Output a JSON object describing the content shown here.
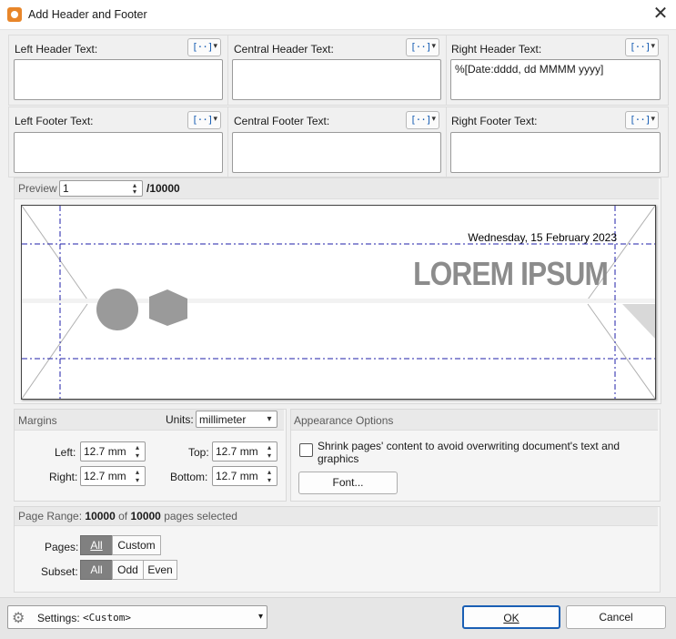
{
  "window": {
    "title": "Add Header and Footer"
  },
  "header": {
    "left_label": "Left Header Text:",
    "central_label": "Central Header Text:",
    "right_label": "Right Header Text:",
    "left_value": "",
    "central_value": "",
    "right_value": "%[Date:dddd, dd MMMM yyyy]"
  },
  "footer": {
    "left_label": "Left Footer Text:",
    "central_label": "Central Footer Text:",
    "right_label": "Right Footer Text:",
    "left_value": "",
    "central_value": "",
    "right_value": ""
  },
  "preview": {
    "label": "Preview",
    "page_value": "1",
    "total": "/10000",
    "date_text": "Wednesday, 15 February 2023",
    "lorem_text": "LOREM IPSUM"
  },
  "margins": {
    "title": "Margins",
    "units_label": "Units:",
    "units_value": "millimeter",
    "left_label": "Left:",
    "left_value": "12.7 mm",
    "right_label": "Right:",
    "right_value": "12.7 mm",
    "top_label": "Top:",
    "top_value": "12.7 mm",
    "bottom_label": "Bottom:",
    "bottom_value": "12.7 mm"
  },
  "appearance": {
    "title": "Appearance Options",
    "shrink_line1": "Shrink pages' content to avoid overwriting document's text and",
    "shrink_line2": "graphics",
    "font_button": "Font..."
  },
  "page_range": {
    "prefix": "Page Range:",
    "selected": "10000",
    "of": "of",
    "total": "10000",
    "suffix": "pages selected",
    "pages_label": "Pages:",
    "pages_all": "All",
    "pages_custom": "Custom",
    "subset_label": "Subset:",
    "subset_all": "All",
    "subset_odd": "Odd",
    "subset_even": "Even"
  },
  "bottom": {
    "settings_label": "Settings:",
    "settings_value": "<Custom>",
    "ok": "OK",
    "cancel": "Cancel"
  },
  "colors": {
    "accent": "#1a5fb4",
    "guide": "#1f1fa8",
    "watermark": "#8c8c8c"
  }
}
